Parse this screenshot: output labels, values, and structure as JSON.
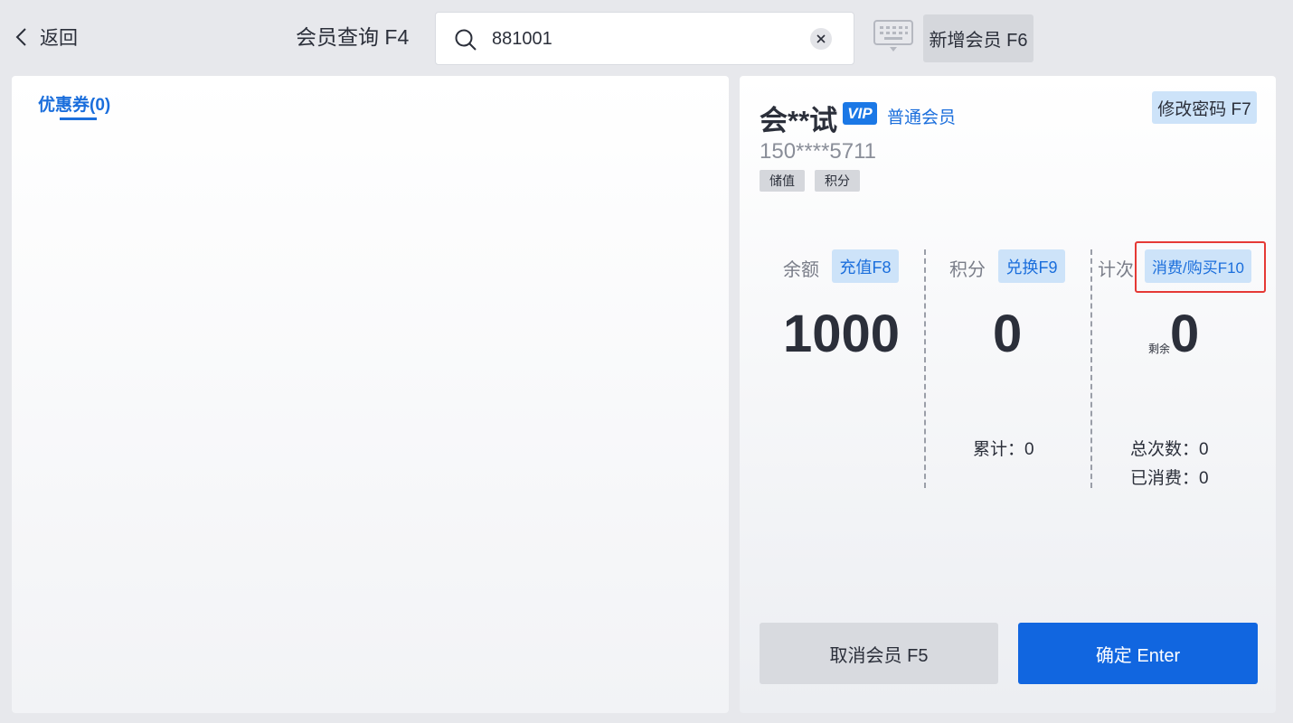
{
  "header": {
    "back_label": "返回",
    "query_label": "会员查询 F4",
    "search_value": "881001",
    "add_member_label": "新增会员 F6"
  },
  "left_panel": {
    "coupon_tab_label": "优惠券(0)"
  },
  "member": {
    "name": "会**试",
    "vip_badge": "VIP",
    "level": "普通会员",
    "phone": "150****5711",
    "tags": [
      "储值",
      "积分"
    ],
    "change_password_label": "修改密码 F7"
  },
  "stats": {
    "balance": {
      "label": "余额",
      "button": "充值F8",
      "value": "1000"
    },
    "points": {
      "label": "积分",
      "button": "兑换F9",
      "value": "0",
      "cumulative": "累计：0"
    },
    "count": {
      "label": "计次",
      "button": "消费/购买F10",
      "remaining_prefix": "剩余",
      "value": "0",
      "total": "总次数：0",
      "consumed": "已消费：0"
    }
  },
  "actions": {
    "cancel_label": "取消会员 F5",
    "confirm_label": "确定 Enter"
  },
  "colors": {
    "accent": "#1166e0",
    "link": "#1a6edc",
    "highlight": "#e53935",
    "light_button": "#cde3f9"
  }
}
